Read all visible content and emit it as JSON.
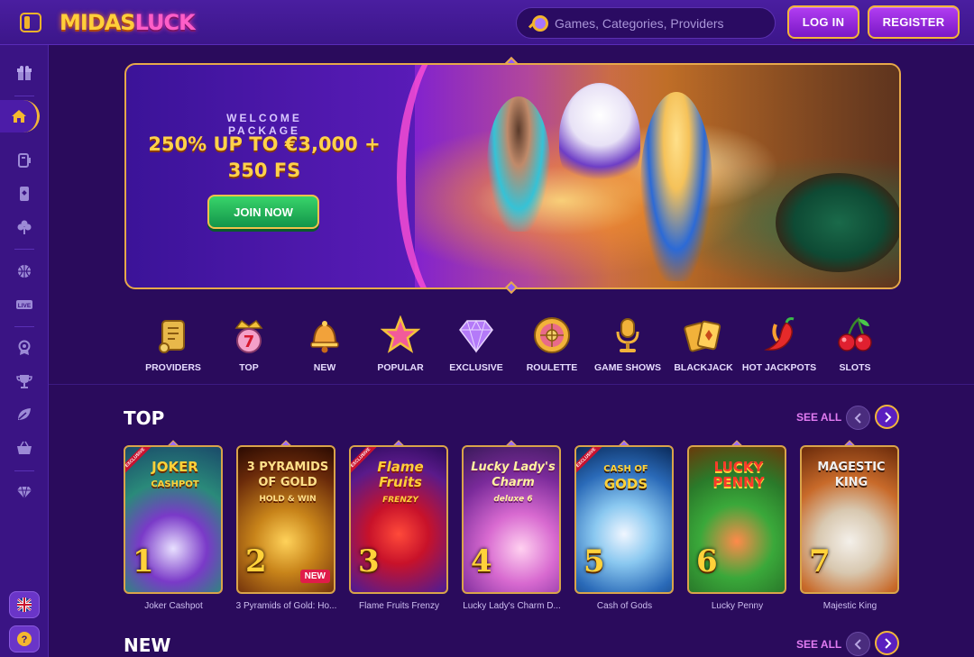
{
  "header": {
    "logo_part1": "MIDAS",
    "logo_part2": "LUCK",
    "search_placeholder": "Games, Categories, Providers",
    "login_label": "LOG IN",
    "register_label": "REGISTER"
  },
  "sidebar": {
    "items": [
      {
        "icon": "gift-icon"
      },
      {
        "icon": "home-icon",
        "active": true
      },
      {
        "icon": "sports-icon"
      },
      {
        "icon": "cards-icon"
      },
      {
        "icon": "clover-icon"
      },
      {
        "icon": "basketball-icon"
      },
      {
        "icon": "live-icon",
        "label": "LIVE"
      },
      {
        "icon": "badge-icon"
      },
      {
        "icon": "trophy-icon"
      },
      {
        "icon": "leaf-icon"
      },
      {
        "icon": "basket-icon"
      },
      {
        "icon": "diamond-icon"
      }
    ],
    "language_icon": "uk-flag-icon",
    "help_icon": "help-icon",
    "help_label": "?"
  },
  "banner": {
    "eyebrow": "WELCOME PACKAGE",
    "title_line1": "250% UP TO €3,000 +",
    "title_line2": "350 FS",
    "cta_label": "JOIN NOW"
  },
  "categories": [
    {
      "label": "PROVIDERS",
      "icon": "scroll-icon"
    },
    {
      "label": "TOP",
      "icon": "crown-seven-icon"
    },
    {
      "label": "NEW",
      "icon": "bell-icon"
    },
    {
      "label": "POPULAR",
      "icon": "star-icon"
    },
    {
      "label": "EXCLUSIVE",
      "icon": "gem-icon"
    },
    {
      "label": "ROULETTE",
      "icon": "roulette-icon"
    },
    {
      "label": "GAME SHOWS",
      "icon": "microphone-icon"
    },
    {
      "label": "BLACKJACK",
      "icon": "cards-icon"
    },
    {
      "label": "HOT JACKPOTS",
      "icon": "chili-icon"
    },
    {
      "label": "SLOTS",
      "icon": "cherry-icon"
    }
  ],
  "sections": {
    "top": {
      "title": "TOP",
      "see_all": "SEE ALL"
    },
    "new": {
      "title": "NEW",
      "see_all": "SEE ALL"
    }
  },
  "top_games": [
    {
      "rank": "1",
      "name": "Joker Cashpot",
      "art_title": "JOKER",
      "art_sub": "CASHPOT",
      "tag": "EXCLUSIVE"
    },
    {
      "rank": "2",
      "name": "3 Pyramids of Gold: Ho...",
      "art_title": "3 PYRAMIDS OF GOLD",
      "art_sub": "HOLD & WIN",
      "badge": "NEW"
    },
    {
      "rank": "3",
      "name": "Flame Fruits Frenzy",
      "art_title": "Flame Fruits",
      "art_sub": "FRENZY",
      "tag": "EXCLUSIVE"
    },
    {
      "rank": "4",
      "name": "Lucky Lady's Charm D...",
      "art_title": "Lucky Lady's Charm",
      "art_sub": "deluxe 6"
    },
    {
      "rank": "5",
      "name": "Cash of Gods",
      "art_title": "CASH OF",
      "art_sub": "GODS",
      "tag": "EXCLUSIVE"
    },
    {
      "rank": "6",
      "name": "Lucky Penny",
      "art_title": "LUCKY",
      "art_sub": "PENNY"
    },
    {
      "rank": "7",
      "name": "Majestic King",
      "art_title": "MAGESTIC",
      "art_sub": "KING"
    }
  ]
}
